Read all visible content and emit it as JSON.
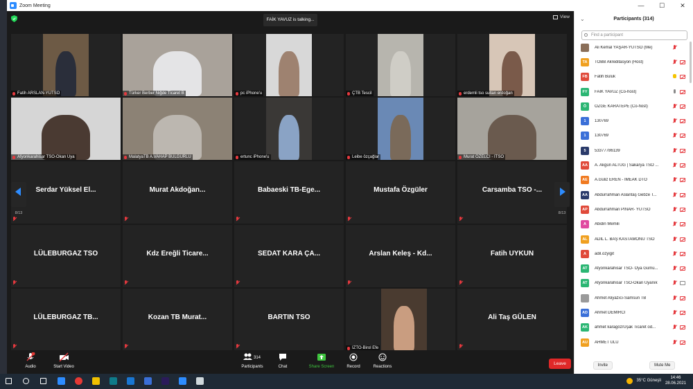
{
  "window": {
    "title": "Zoom Meeting",
    "minimize": "—",
    "maximize": "☐",
    "close": "✕"
  },
  "top": {
    "speaking": "FAİK YAVUZ is talking...",
    "view_label": "View"
  },
  "pager": {
    "page": "8/13"
  },
  "tiles": [
    {
      "name": "Fatih ARSLAN-YÜTSO",
      "video": true,
      "bg": "#6d5a45",
      "fg": "#2a2e3a"
    },
    {
      "name": "Türker Berber Niğde Ticaret B",
      "video": true,
      "bg": "#a9a29a",
      "fg": "#e4e4e6"
    },
    {
      "name": "pc iPhone'u",
      "video": true,
      "bg": "#d8d8d8",
      "fg": "#9e8270"
    },
    {
      "name": "ÇTB Tescil",
      "video": true,
      "bg": "#b7b5ae",
      "fg": "#cfcdc6"
    },
    {
      "name": "erdemli tso sultan erdoğan",
      "video": true,
      "bg": "#d7c6b7",
      "fg": "#7a5a4a"
    },
    {
      "name": "Afyonkarahisar TSO-Okan Uya",
      "video": true,
      "bg": "#d6d6d6",
      "fg": "#4a3a32"
    },
    {
      "name": "MalatyaTB A.VAHAP BULGURLU",
      "video": true,
      "bg": "#8c8275",
      "fg": "#bcb7b0"
    },
    {
      "name": "ertunc iPhone'u",
      "video": true,
      "bg": "#3a3836",
      "fg": "#8aa3c5"
    },
    {
      "name": "Leibe özçağlar",
      "video": true,
      "bg": "#6a89b5",
      "fg": "#7a6a5a"
    },
    {
      "name": "Murat ÖZELCİ - İTSO",
      "video": true,
      "bg": "#a6a39c",
      "fg": "#6a5a4e"
    },
    {
      "name": "Serdar Yüksel El...",
      "video": false
    },
    {
      "name": "Murat  Akdoğan...",
      "video": false
    },
    {
      "name": "Babaeski TB-Ege...",
      "video": false
    },
    {
      "name": "Mustafa Özgüler",
      "video": false
    },
    {
      "name": "Carsamba TSO -...",
      "video": false
    },
    {
      "name": "LÜLEBURGAZ TSO",
      "video": false
    },
    {
      "name": "Kdz Ereğli Ticare...",
      "video": false
    },
    {
      "name": "SEDAT KARA ÇA...",
      "video": false
    },
    {
      "name": "Arslan Keleş - Kd...",
      "video": false
    },
    {
      "name": "Fatih UYKUN",
      "video": false
    },
    {
      "name": "LÜLEBURGAZ TB...",
      "video": false
    },
    {
      "name": "Kozan TB Murat...",
      "video": false
    },
    {
      "name": "BARTIN TSO",
      "video": false
    },
    {
      "name": "İZTO-Birol Efe",
      "video": true,
      "bg": "#4a3b30",
      "fg": "#c99d80"
    },
    {
      "name": "Ali Taş GÜLEN",
      "video": false
    }
  ],
  "toolbar": {
    "audio": "Audio",
    "start_video": "Start Video",
    "participants": "Participants",
    "participants_count": "314",
    "chat": "Chat",
    "share_screen": "Share Screen",
    "record": "Record",
    "reactions": "Reactions",
    "leave": "Leave",
    "audio_badge": "1"
  },
  "panel": {
    "title": "Participants (314)",
    "search_placeholder": "Find a participant",
    "invite": "Invite",
    "mute_me": "Mute Me",
    "participants": [
      {
        "initials": "",
        "name": "Ali Kemal YAŞAR-YÜTSO (Me)",
        "color": "#8a6e58",
        "mic": "slash",
        "cam": "none"
      },
      {
        "initials": "TA",
        "name": "TOBB Akreditasyon (Host)",
        "color": "#f0a020",
        "mic": "slash",
        "cam": "slash"
      },
      {
        "initials": "FB",
        "name": "Fatih Buluk",
        "color": "#e04a3a",
        "mic": "hand",
        "cam": "slash"
      },
      {
        "initials": "FY",
        "name": "FAİK YAVUZ (Co-host)",
        "color": "#2bb673",
        "mic": "on",
        "cam": "slash"
      },
      {
        "initials": "Ö",
        "name": "ÖZGE KARATEPE (Co-host)",
        "color": "#2bb673",
        "mic": "slash",
        "cam": "slash"
      },
      {
        "initials": "1",
        "name": "130769",
        "color": "#3a6fd8",
        "mic": "slash",
        "cam": "slash"
      },
      {
        "initials": "1",
        "name": "130769",
        "color": "#3a6fd8",
        "mic": "slash",
        "cam": "slash"
      },
      {
        "initials": "5",
        "name": "53377786139",
        "color": "#2a3a6a",
        "mic": "slash",
        "cam": "slash"
      },
      {
        "initials": "AA",
        "name": "A. Akgün ALTUĞ | Sakarya TSO ...",
        "color": "#e04a3a",
        "mic": "slash",
        "cam": "slash"
      },
      {
        "initials": "AE",
        "name": "A.Güliz EREN - IMEAK DTO",
        "color": "#f07a20",
        "mic": "slash",
        "cam": "slash"
      },
      {
        "initials": "AA",
        "name": "Abdurrahman Aslantaş Gebze T...",
        "color": "#2a3a6a",
        "mic": "slash",
        "cam": "slash"
      },
      {
        "initials": "AP",
        "name": "Abdurrahman PINAR- YÜTSO",
        "color": "#e04a3a",
        "mic": "slash",
        "cam": "slash"
      },
      {
        "initials": "A",
        "name": "Abidin Memili",
        "color": "#e04aa0",
        "mic": "slash",
        "cam": "slash"
      },
      {
        "initials": "AL",
        "name": "ADİL L. BAŞ KASTAMONU TSO",
        "color": "#f0a020",
        "mic": "slash",
        "cam": "slash"
      },
      {
        "initials": "A",
        "name": "adil.ozyigit",
        "color": "#e04a3a",
        "mic": "slash",
        "cam": "slash"
      },
      {
        "initials": "AT",
        "name": "Afyonkarahisar TSO- Oya Gümü...",
        "color": "#2bb673",
        "mic": "slash",
        "cam": "slash"
      },
      {
        "initials": "AT",
        "name": "Afyonkarahisar TSO-Okan Uyanık",
        "color": "#2bb673",
        "mic": "slash",
        "cam": "ok"
      },
      {
        "initials": "",
        "name": "Ahmet Aliyazıcı-Samsun TB",
        "color": "#9a9a9a",
        "mic": "slash",
        "cam": "slash"
      },
      {
        "initials": "AD",
        "name": "Ahmet DEMİRCİ",
        "color": "#3a6fd8",
        "mic": "slash",
        "cam": "slash"
      },
      {
        "initials": "AK",
        "name": "ahmet karagöz/Uşak Ticaret od...",
        "color": "#2bb673",
        "mic": "slash",
        "cam": "slash"
      },
      {
        "initials": "AU",
        "name": "AHMET ULU",
        "color": "#f0a020",
        "mic": "slash",
        "cam": "slash"
      }
    ]
  },
  "taskbar": {
    "weather": "35°C  Güneşli",
    "time": "14:46",
    "date": "28.06.2021",
    "icon_colors": [
      "#ffffff",
      "#ffffff",
      "#ffffff",
      "#2d8cff",
      "#e53935",
      "#f0c000",
      "#0f7b8a",
      "#1976d2",
      "#3a6fd8",
      "#2b1b5a",
      "#2d8cff",
      "#cfd8dc"
    ]
  }
}
